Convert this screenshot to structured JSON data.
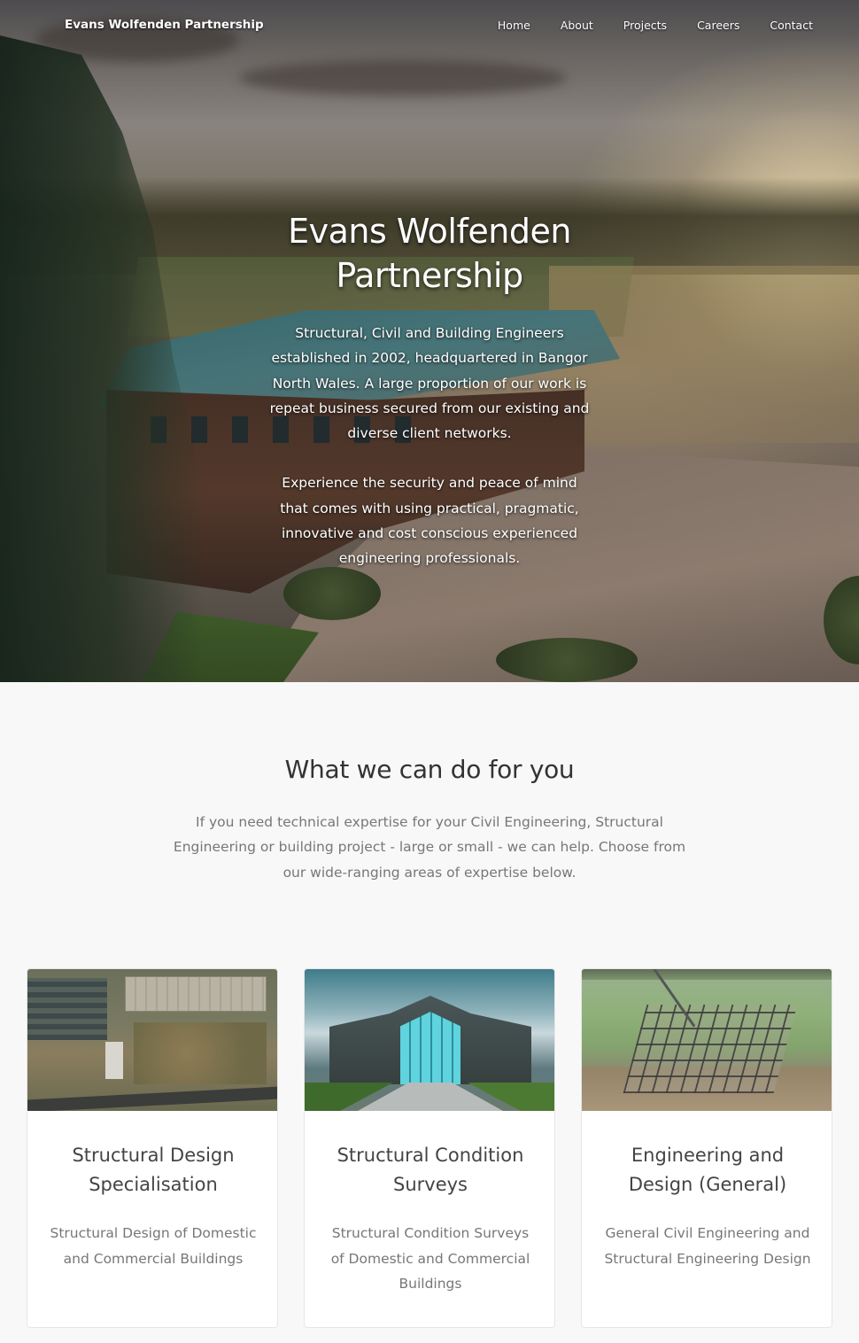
{
  "nav": {
    "brand": "Evans Wolfenden Partnership",
    "links": [
      "Home",
      "About",
      "Projects",
      "Careers",
      "Contact"
    ]
  },
  "hero": {
    "title": "Evans Wolfenden Partnership",
    "paragraph1": "Structural, Civil and Building Engineers established in 2002, headquartered in Bangor North Wales. A large proportion of our work is repeat business secured from our existing and diverse client networks.",
    "paragraph2": "Experience the security and peace of mind that comes with using practical, pragmatic, innovative and cost conscious experienced engineering professionals."
  },
  "services": {
    "title": "What we can do for you",
    "intro": "If you need technical expertise for your Civil Engineering, Structural Engineering or building project - large or small - we can help. Choose from our wide-ranging areas of expertise below.",
    "cards": [
      {
        "title": "Structural Design Specialisation",
        "description": "Structural Design of Domestic and Commercial Buildings"
      },
      {
        "title": "Structural Condition Surveys",
        "description": "Structural Condition Surveys of Domestic and Commercial Buildings"
      },
      {
        "title": "Engineering and Design (General)",
        "description": "General Civil Engineering and Structural Engineering Design"
      }
    ]
  }
}
